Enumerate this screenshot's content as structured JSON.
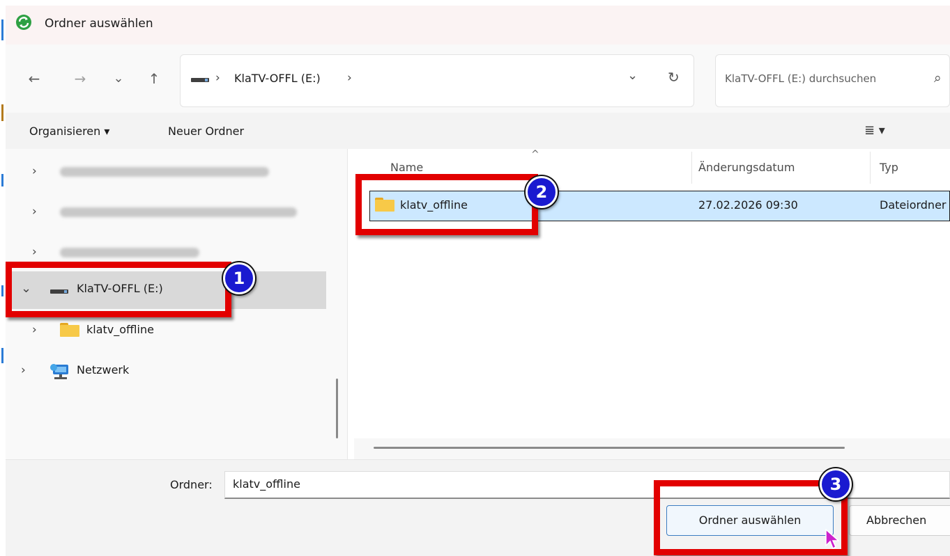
{
  "window": {
    "title": "Ordner auswählen"
  },
  "nav": {
    "back_icon": "←",
    "forward_icon": "→",
    "recent_icon": "⌄",
    "up_icon": "↑",
    "breadcrumb_sep1": "›",
    "breadcrumb_drive": "KlaTV-OFFL (E:)",
    "breadcrumb_sep2": "›",
    "dropdown_icon": "⌄",
    "refresh_icon": "↻",
    "search_placeholder": "KlaTV-OFFL (E:) durchsuchen",
    "search_icon": "⌕"
  },
  "toolbar": {
    "organize": "Organisieren ▾",
    "new_folder": "Neuer Ordner",
    "view_icon": "≣ ▾"
  },
  "tree": {
    "items": [
      {
        "label": "KlaTV-OFFL (E:)",
        "expand": "⌄"
      },
      {
        "label": "klatv_offline",
        "expand": "›"
      },
      {
        "label": "Netzwerk",
        "expand": "›"
      }
    ],
    "collapsed_chevron": "›"
  },
  "list": {
    "sort_arrow": "^",
    "columns": {
      "name": "Name",
      "date": "Änderungsdatum",
      "type": "Typ"
    },
    "rows": [
      {
        "name": "klatv_offline",
        "date": "27.02.2026 09:30",
        "type": "Dateiordner"
      }
    ]
  },
  "footer": {
    "folder_label": "Ordner:",
    "folder_value": "klatv_offline",
    "select_button": "Ordner auswählen",
    "cancel_button": "Abbrechen"
  },
  "annotations": {
    "badge1": "1",
    "badge2": "2",
    "badge3": "3"
  },
  "colors": {
    "highlight": "#e20000",
    "badge": "#1a1ad0",
    "selection": "#cce8ff",
    "accent": "#0067c0"
  }
}
